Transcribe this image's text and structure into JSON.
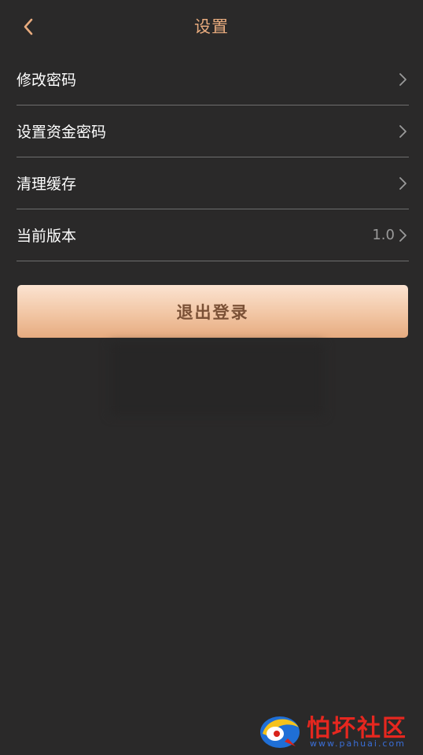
{
  "header": {
    "title": "设置"
  },
  "menu": {
    "items": [
      {
        "label": "修改密码",
        "value": ""
      },
      {
        "label": "设置资金密码",
        "value": ""
      },
      {
        "label": "清理缓存",
        "value": ""
      },
      {
        "label": "当前版本",
        "value": "1.0"
      }
    ]
  },
  "logout": {
    "label": "退出登录"
  },
  "watermark": {
    "name": "怕坏社区",
    "url": "www.pahuai.com"
  },
  "colors": {
    "background": "#2a2929",
    "title": "#e8ab7e",
    "divider": "#6e6e6e",
    "button_gradient_top": "#fbe3d1",
    "button_gradient_bottom": "#e6ab80",
    "button_text": "#7b5136"
  },
  "icons": {
    "back": "chevron-left-icon",
    "row_arrow": "chevron-right-icon"
  }
}
